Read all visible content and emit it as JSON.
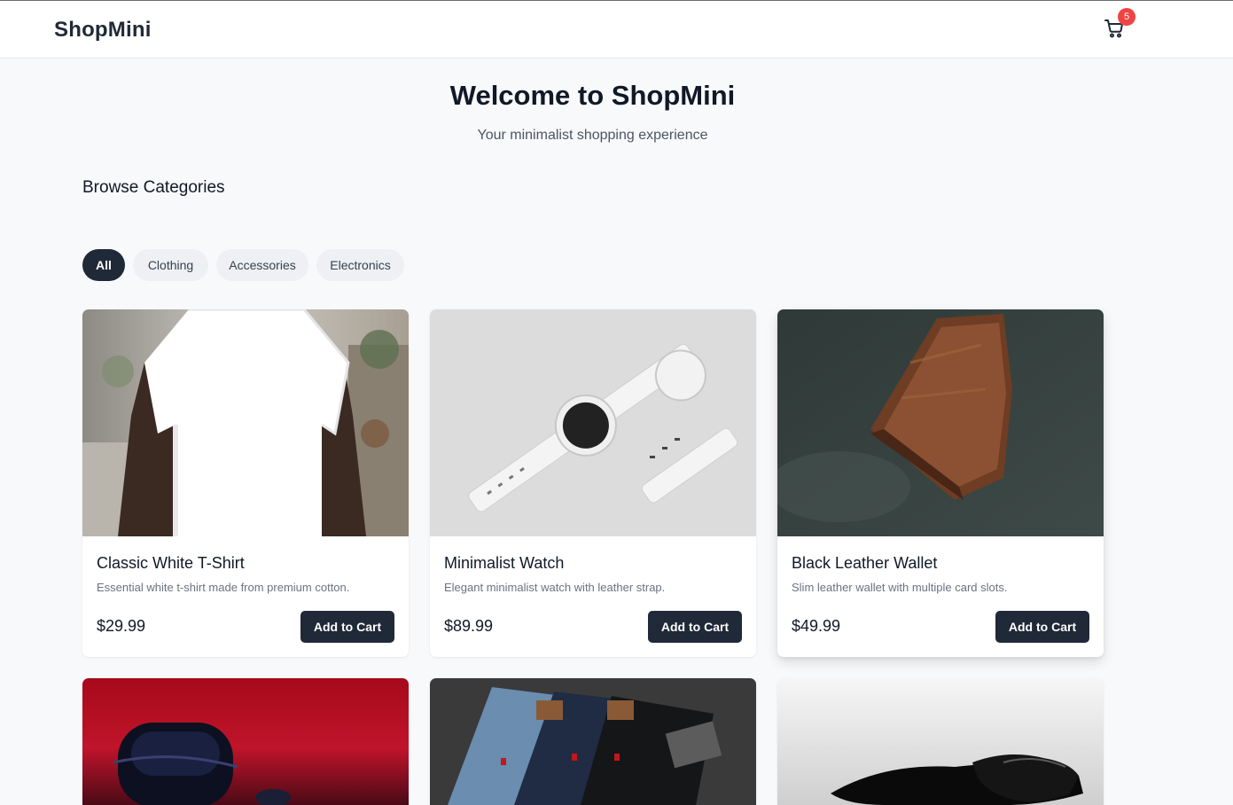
{
  "header": {
    "logo": "ShopMini",
    "cart_count": "5"
  },
  "hero": {
    "title": "Welcome to ShopMini",
    "subtitle": "Your minimalist shopping experience"
  },
  "categories": {
    "title": "Browse Categories",
    "filters": [
      "All",
      "Clothing",
      "Accessories",
      "Electronics"
    ],
    "active": "All"
  },
  "products": [
    {
      "name": "Classic White T-Shirt",
      "description": "Essential white t-shirt made from premium cotton.",
      "price": "$29.99",
      "button": "Add to Cart"
    },
    {
      "name": "Minimalist Watch",
      "description": "Elegant minimalist watch with leather strap.",
      "price": "$89.99",
      "button": "Add to Cart"
    },
    {
      "name": "Black Leather Wallet",
      "description": "Slim leather wallet with multiple card slots.",
      "price": "$49.99",
      "button": "Add to Cart"
    }
  ],
  "icons": {
    "cart": "shopping-cart-icon"
  },
  "colors": {
    "primary": "#1f2937",
    "badge": "#ef4444",
    "background": "#f8f9fb"
  }
}
